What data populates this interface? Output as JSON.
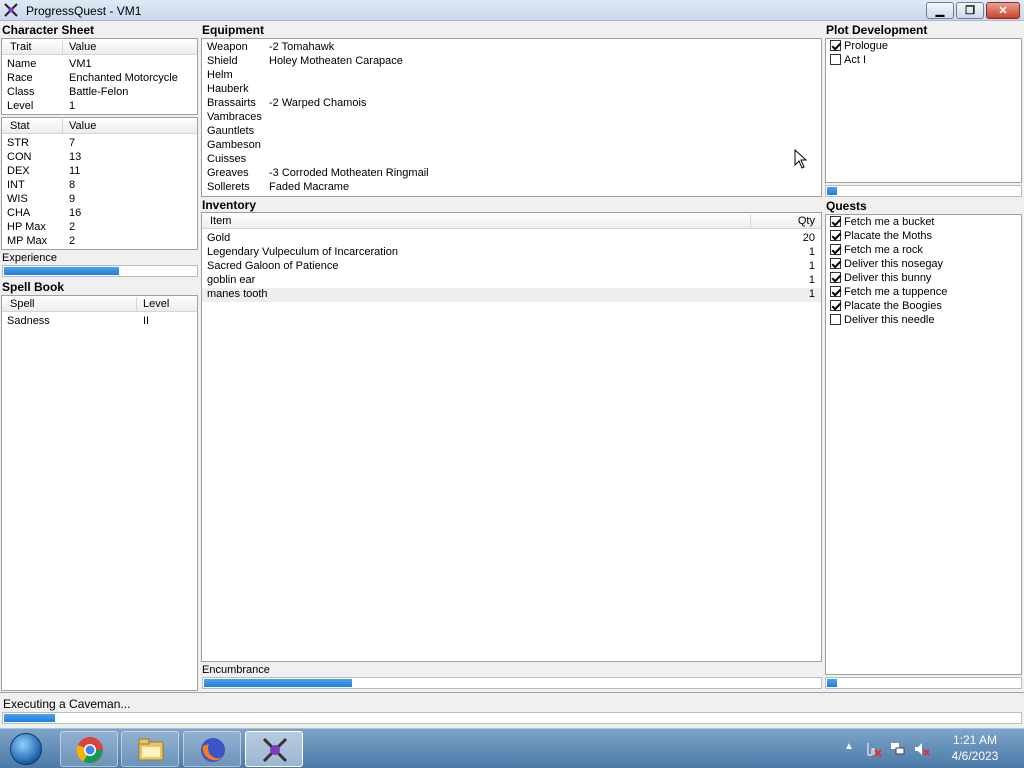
{
  "window": {
    "title": "ProgressQuest - VM1"
  },
  "character_sheet": {
    "title": "Character Sheet",
    "trait_header": "Trait",
    "value_header": "Value",
    "traits": [
      {
        "label": "Name",
        "value": "VM1"
      },
      {
        "label": "Race",
        "value": "Enchanted Motorcycle"
      },
      {
        "label": "Class",
        "value": "Battle-Felon"
      },
      {
        "label": "Level",
        "value": "1"
      }
    ],
    "stat_header": "Stat",
    "stat_value_header": "Value",
    "stats": [
      {
        "label": "STR",
        "value": "7"
      },
      {
        "label": "CON",
        "value": "13"
      },
      {
        "label": "DEX",
        "value": "11"
      },
      {
        "label": "INT",
        "value": "8"
      },
      {
        "label": "WIS",
        "value": "9"
      },
      {
        "label": "CHA",
        "value": "16"
      },
      {
        "label": "HP Max",
        "value": "2"
      },
      {
        "label": "MP Max",
        "value": "2"
      }
    ],
    "experience_label": "Experience",
    "experience_progress": 0.6
  },
  "spell_book": {
    "title": "Spell Book",
    "spell_header": "Spell",
    "level_header": "Level",
    "spells": [
      {
        "name": "Sadness",
        "level": "II"
      }
    ]
  },
  "equipment": {
    "title": "Equipment",
    "slots": [
      {
        "slot": "Weapon",
        "item": "-2 Tomahawk"
      },
      {
        "slot": "Shield",
        "item": "Holey Motheaten Carapace"
      },
      {
        "slot": "Helm",
        "item": ""
      },
      {
        "slot": "Hauberk",
        "item": ""
      },
      {
        "slot": "Brassairts",
        "item": "-2 Warped Chamois"
      },
      {
        "slot": "Vambraces",
        "item": ""
      },
      {
        "slot": "Gauntlets",
        "item": ""
      },
      {
        "slot": "Gambeson",
        "item": ""
      },
      {
        "slot": "Cuisses",
        "item": ""
      },
      {
        "slot": "Greaves",
        "item": "-3 Corroded Motheaten Ringmail"
      },
      {
        "slot": "Sollerets",
        "item": "Faded Macrame"
      }
    ]
  },
  "inventory": {
    "title": "Inventory",
    "item_header": "Item",
    "qty_header": "Qty",
    "items": [
      {
        "name": "Gold",
        "qty": "20"
      },
      {
        "name": "Legendary Vulpeculum of Incarceration",
        "qty": "1"
      },
      {
        "name": "Sacred Galoon of Patience",
        "qty": "1"
      },
      {
        "name": "goblin ear",
        "qty": "1"
      },
      {
        "name": "manes tooth",
        "qty": "1"
      }
    ],
    "encumbrance_label": "Encumbrance",
    "encumbrance_progress": 0.24
  },
  "plot": {
    "title": "Plot Development",
    "acts": [
      {
        "label": "Prologue",
        "checked": true
      },
      {
        "label": "Act I",
        "checked": false
      }
    ],
    "progress": 0.05
  },
  "quests": {
    "title": "Quests",
    "items": [
      {
        "label": "Fetch me a bucket",
        "checked": true
      },
      {
        "label": "Placate the Moths",
        "checked": true
      },
      {
        "label": "Fetch me a rock",
        "checked": true
      },
      {
        "label": "Deliver this nosegay",
        "checked": true
      },
      {
        "label": "Deliver this bunny",
        "checked": true
      },
      {
        "label": "Fetch me a tuppence",
        "checked": true
      },
      {
        "label": "Placate the Boogies",
        "checked": true
      },
      {
        "label": "Deliver this needle",
        "checked": false
      }
    ],
    "progress": 0.05
  },
  "status": {
    "text": "Executing a Caveman...",
    "progress": 0.05
  },
  "taskbar": {
    "apps": [
      "chrome-icon",
      "file-explorer-icon",
      "firefox-icon",
      "progressquest-icon"
    ],
    "time": "1:21 AM",
    "date": "4/6/2023"
  },
  "colors": {
    "progress_fill": "#1e7fd9",
    "titlebar": "#c9d8ec",
    "taskbar": "#4b7aa8"
  }
}
